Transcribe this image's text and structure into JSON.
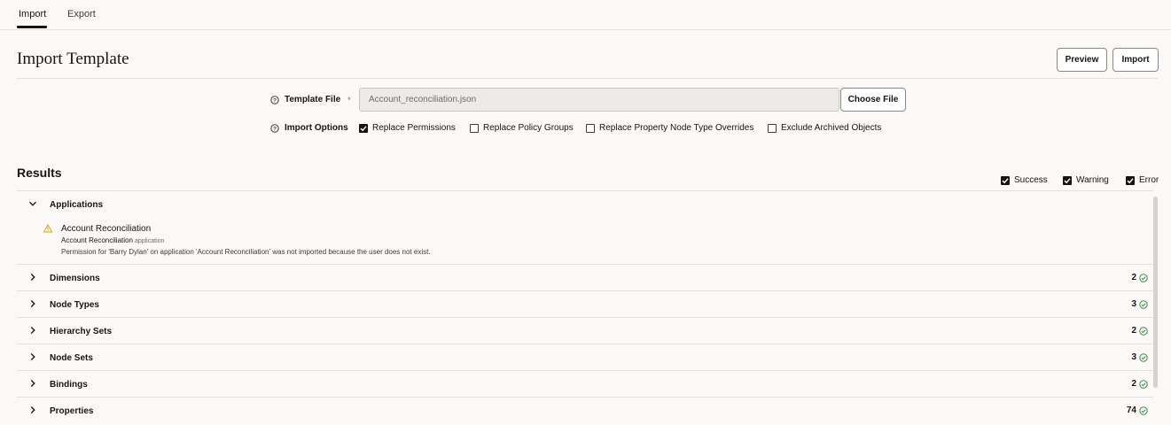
{
  "tabs": [
    {
      "label": "Import",
      "active": true
    },
    {
      "label": "Export",
      "active": false
    }
  ],
  "page": {
    "title": "Import Template",
    "preview_label": "Preview",
    "import_label": "Import"
  },
  "form": {
    "template_file_label": "Template File",
    "required_marker": "*",
    "template_file_value": "Account_reconciliation.json",
    "choose_file_label": "Choose File",
    "import_options_label": "Import Options",
    "options": [
      {
        "label": "Replace Permissions",
        "checked": true
      },
      {
        "label": "Replace Policy Groups",
        "checked": false
      },
      {
        "label": "Replace Property Node Type Overrides",
        "checked": false
      },
      {
        "label": "Exclude Archived Objects",
        "checked": false
      }
    ]
  },
  "results": {
    "title": "Results",
    "filters": [
      {
        "label": "Success",
        "checked": true
      },
      {
        "label": "Warning",
        "checked": true
      },
      {
        "label": "Error",
        "checked": true
      }
    ],
    "sections": [
      {
        "label": "Applications",
        "expanded": true,
        "count": "",
        "detail": {
          "icon": "warning-icon",
          "name": "Account Reconciliation",
          "sub_name": "Account Reconciliation",
          "sub_type": "application",
          "message": "Permission for 'Barry Dylan' on application 'Account Reconciliation' was not imported because the user does not exist."
        }
      },
      {
        "label": "Dimensions",
        "expanded": false,
        "count": "2"
      },
      {
        "label": "Node Types",
        "expanded": false,
        "count": "3"
      },
      {
        "label": "Hierarchy Sets",
        "expanded": false,
        "count": "2"
      },
      {
        "label": "Node Sets",
        "expanded": false,
        "count": "3"
      },
      {
        "label": "Bindings",
        "expanded": false,
        "count": "2"
      },
      {
        "label": "Properties",
        "expanded": false,
        "count": "74"
      }
    ]
  },
  "colors": {
    "success": "#3f8a4a",
    "warning": "#e0a21a",
    "text": "#161513",
    "background": "#fbf9f8"
  }
}
